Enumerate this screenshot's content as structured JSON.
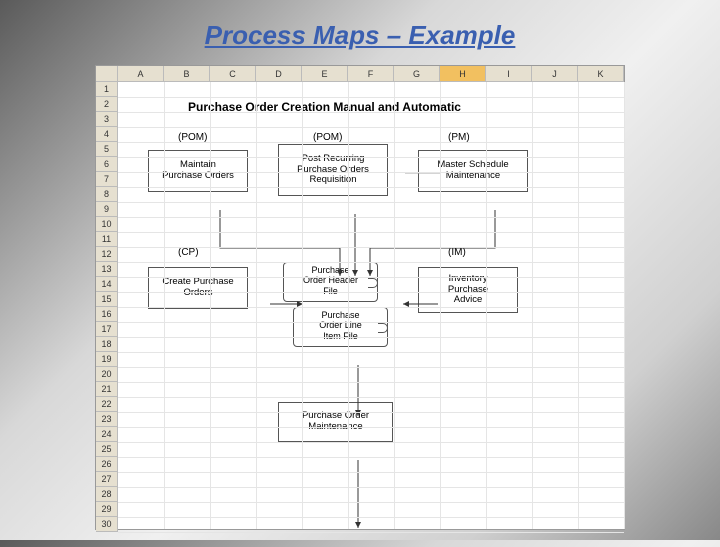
{
  "slide": {
    "title": "Process Maps – Example"
  },
  "spreadsheet": {
    "columns": [
      "A",
      "B",
      "C",
      "D",
      "E",
      "F",
      "G",
      "H",
      "I",
      "J",
      "K"
    ],
    "selected_col": "H",
    "row_count": 30,
    "title": "Purchase Order Creation Manual and Automatic"
  },
  "labels": {
    "pom1": "(POM)",
    "pom2": "(POM)",
    "pm": "(PM)",
    "cp": "(CP)",
    "im": "(IM)"
  },
  "boxes": {
    "maintain_po": "Maintain\nPurchase Orders",
    "post_recurring": "Post Recurring\nPurchase Orders\nRequisition",
    "master_schedule": "Master Schedule\nMaintenance",
    "create_po": "Create Purchase\nOrders",
    "po_header_file": "Purchase\nOrder Header\nFile",
    "po_line_file": "Purchase\nOrder Line\nItem File",
    "inventory_advice": "Inventory\nPurchase\nAdvice",
    "po_maintenance": "Purchase Order\nMaintenance"
  }
}
